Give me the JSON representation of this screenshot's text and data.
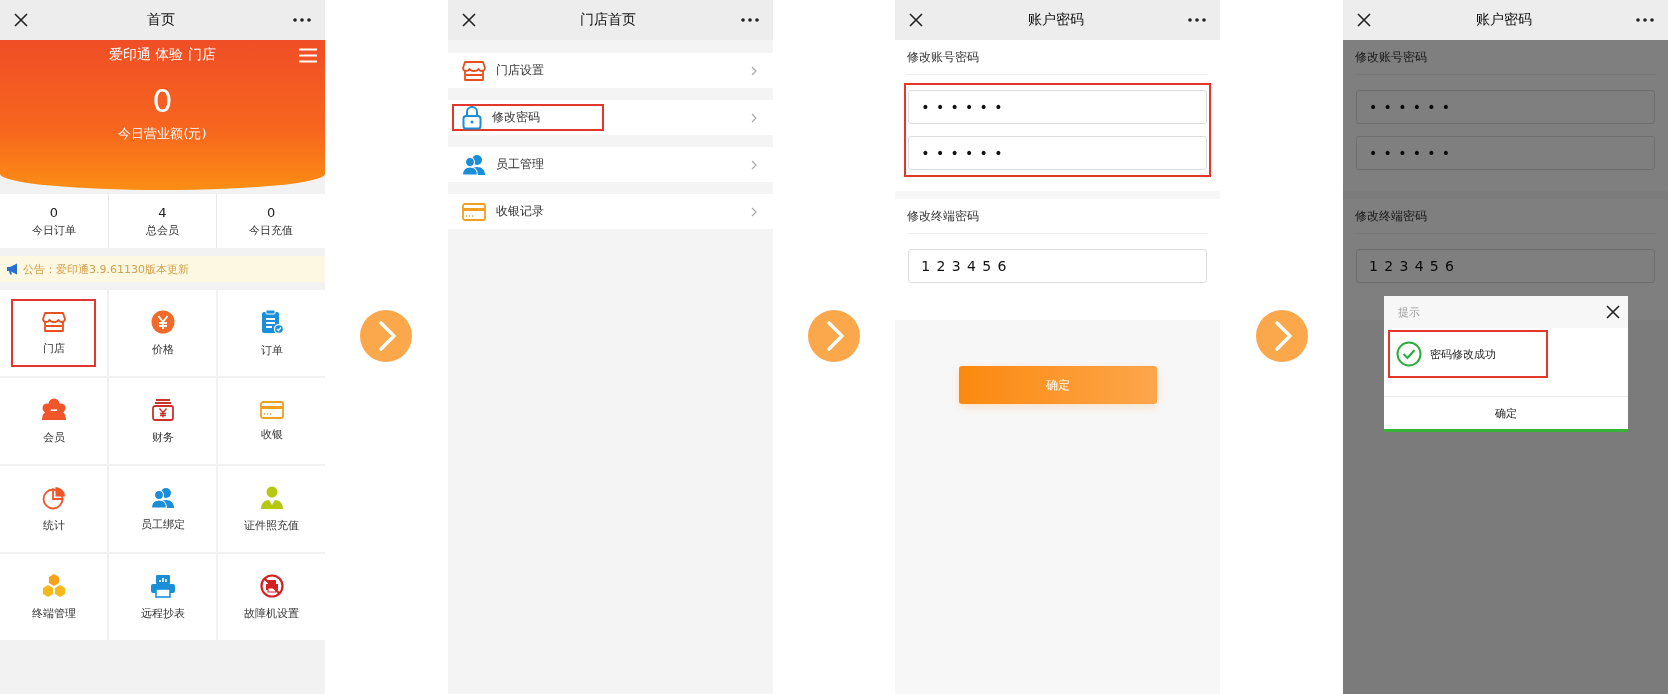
{
  "screens": [
    {
      "kind": "home",
      "title": "首页",
      "store_name": "爱印通 体验 门店",
      "revenue": {
        "value": "0",
        "label": "今日营业额(元)"
      },
      "stats": [
        {
          "value": "0",
          "label": "今日订单"
        },
        {
          "value": "4",
          "label": "总会员"
        },
        {
          "value": "0",
          "label": "今日充值"
        }
      ],
      "notice": "公告：爱印通3.9.61130版本更新",
      "grid": [
        {
          "label": "门店",
          "highlighted": true
        },
        {
          "label": "价格",
          "highlighted": false
        },
        {
          "label": "订单",
          "highlighted": false
        },
        {
          "label": "会员",
          "highlighted": false
        },
        {
          "label": "财务",
          "highlighted": false
        },
        {
          "label": "收银",
          "highlighted": false
        },
        {
          "label": "统计",
          "highlighted": false
        },
        {
          "label": "员工绑定",
          "highlighted": false
        },
        {
          "label": "证件照充值",
          "highlighted": false
        },
        {
          "label": "终端管理",
          "highlighted": false
        },
        {
          "label": "远程抄表",
          "highlighted": false
        },
        {
          "label": "故障机设置",
          "highlighted": false
        }
      ]
    },
    {
      "kind": "menu",
      "title": "门店首页",
      "items": [
        {
          "label": "门店设置",
          "highlighted": false
        },
        {
          "label": "修改密码",
          "highlighted": true
        },
        {
          "label": "员工管理",
          "highlighted": false
        },
        {
          "label": "收银记录",
          "highlighted": false
        }
      ]
    },
    {
      "kind": "form",
      "title": "账户密码",
      "sections": [
        {
          "label": "修改账号密码",
          "highlighted": true,
          "fields": [
            {
              "value": "••••••"
            },
            {
              "value": "••••••"
            }
          ]
        },
        {
          "label": "修改终端密码",
          "highlighted": false,
          "fields": [
            {
              "value": "123456"
            }
          ]
        }
      ],
      "submit": "确定"
    },
    {
      "kind": "form",
      "title": "账户密码",
      "sections": [
        {
          "label": "修改账号密码",
          "highlighted": false,
          "fields": [
            {
              "value": "••••••"
            },
            {
              "value": "••••••"
            }
          ]
        },
        {
          "label": "修改终端密码",
          "highlighted": false,
          "fields": [
            {
              "value": "123456"
            }
          ]
        }
      ],
      "dialog": {
        "title": "提示",
        "message": "密码修改成功",
        "highlighted": true,
        "button": "确定"
      }
    }
  ]
}
